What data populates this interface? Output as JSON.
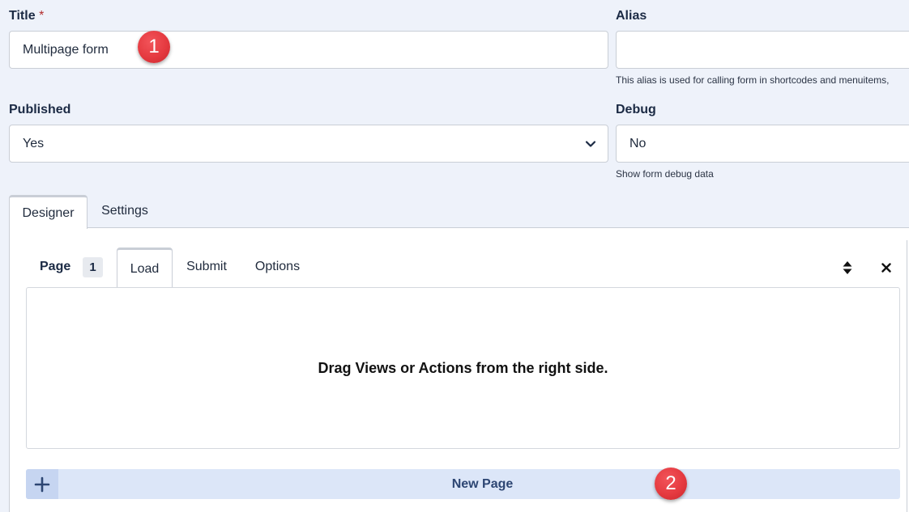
{
  "form": {
    "title": {
      "label": "Title",
      "required_mark": "*",
      "value": "Multipage form"
    },
    "alias": {
      "label": "Alias",
      "value": "",
      "hint": "This alias is used for calling form in shortcodes and menuitems,"
    },
    "published": {
      "label": "Published",
      "selected": "Yes"
    },
    "debug": {
      "label": "Debug",
      "selected": "No",
      "hint": "Show form debug data"
    }
  },
  "outer_tabs": [
    {
      "label": "Designer",
      "active": true
    },
    {
      "label": "Settings",
      "active": false
    }
  ],
  "page_editor": {
    "page_label": "Page",
    "page_number": "1",
    "tabs": [
      {
        "label": "Load",
        "active": true
      },
      {
        "label": "Submit",
        "active": false
      },
      {
        "label": "Options",
        "active": false
      }
    ],
    "dropzone_text": "Drag Views or Actions from the right side.",
    "new_page_label": "New Page"
  },
  "markers": [
    {
      "label": "1"
    },
    {
      "label": "2"
    }
  ],
  "colors": {
    "background": "#eef2fa",
    "marker": "#e53a40",
    "new_page_bar": "#dce6f8",
    "new_page_text": "#2d4673"
  }
}
